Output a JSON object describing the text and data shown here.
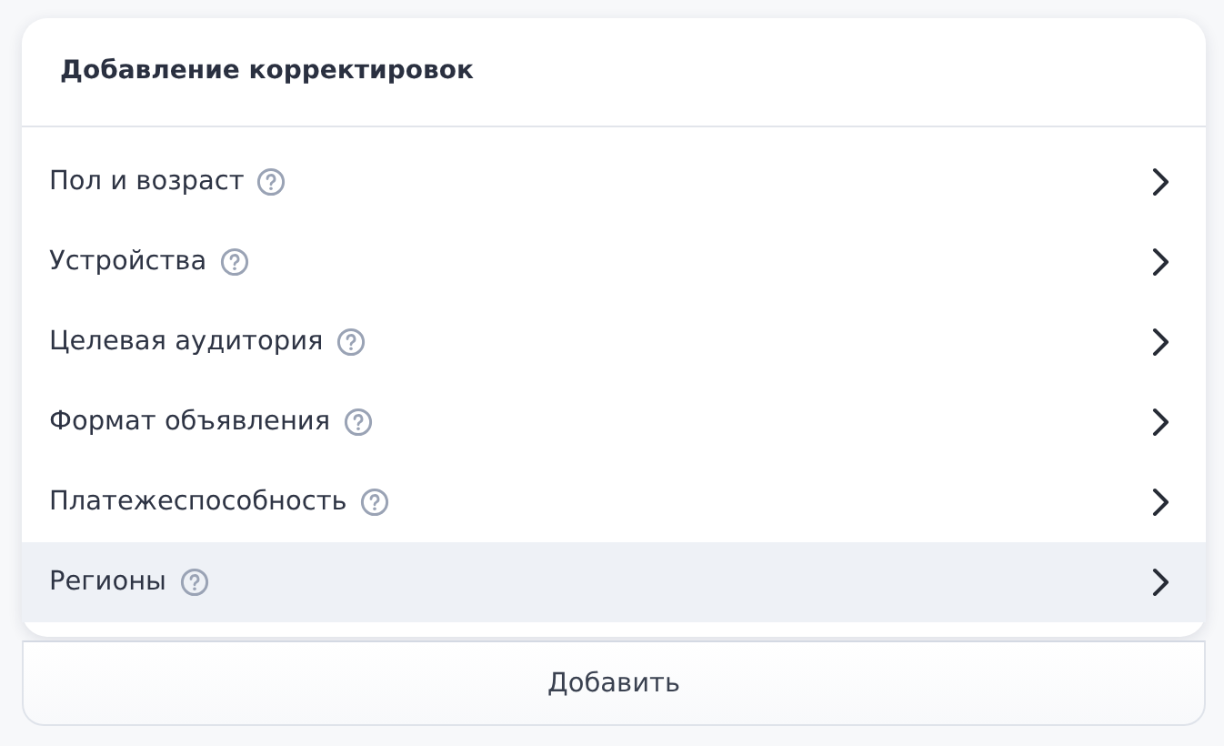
{
  "popup": {
    "title": "Добавление корректировок",
    "items": [
      {
        "label": "Пол и возраст",
        "selected": false
      },
      {
        "label": "Устройства",
        "selected": false
      },
      {
        "label": "Целевая аудитория",
        "selected": false
      },
      {
        "label": "Формат объявления",
        "selected": false
      },
      {
        "label": "Платежеспособность",
        "selected": false
      },
      {
        "label": "Регионы",
        "selected": true
      }
    ]
  },
  "add_button": {
    "label": "Добавить"
  }
}
